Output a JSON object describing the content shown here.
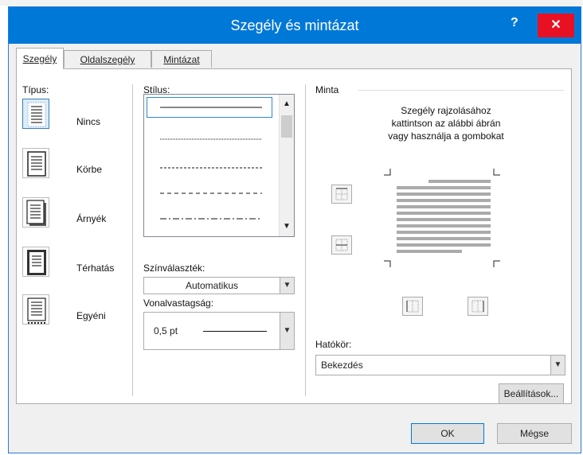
{
  "window": {
    "title": "Szegély és mintázat",
    "help_label": "?",
    "close_label": "✕"
  },
  "tabs": [
    {
      "label": "Szegély",
      "active": true
    },
    {
      "label": "Oldalszegély",
      "active": false
    },
    {
      "label": "Mintázat",
      "active": false
    }
  ],
  "setting": {
    "label": "Típus:",
    "items": [
      {
        "label": "Nincs",
        "selected": true,
        "icon": "no-border-icon"
      },
      {
        "label": "Körbe",
        "selected": false,
        "icon": "box-border-icon"
      },
      {
        "label": "Árnyék",
        "selected": false,
        "icon": "shadow-border-icon"
      },
      {
        "label": "Térhatás",
        "selected": false,
        "icon": "3d-border-icon"
      },
      {
        "label": "Egyéni",
        "selected": false,
        "icon": "custom-border-icon"
      }
    ]
  },
  "style": {
    "label": "Stílus:",
    "items": [
      "solid",
      "dotted",
      "dashed-small",
      "dashed",
      "dash-dot"
    ],
    "selected": "solid"
  },
  "color": {
    "label": "Színválaszték:",
    "value": "Automatikus"
  },
  "width": {
    "label": "Vonalvastagság:",
    "value": "0,5 pt"
  },
  "preview": {
    "label": "Minta",
    "instructions_line1": "Szegély rajzolásához",
    "instructions_line2": "kattintson az alábbi ábrán",
    "instructions_line3": "vagy használja a gombokat"
  },
  "apply_to": {
    "label": "Hatókör:",
    "value": "Bekezdés"
  },
  "buttons": {
    "options": "Beállítások...",
    "ok": "OK",
    "cancel": "Mégse"
  },
  "colors": {
    "titlebar": "#0078d7",
    "close": "#e81123",
    "selection_border": "#2a8ad4"
  }
}
